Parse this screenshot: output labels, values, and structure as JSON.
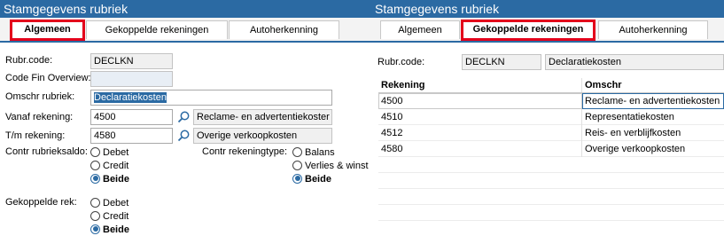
{
  "left": {
    "title": "Stamgegevens rubriek",
    "tabs": [
      "Algemeen",
      "Gekoppelde rekeningen",
      "Autoherkenning"
    ],
    "active_tab": "Algemeen",
    "fields": {
      "rubr_code_label": "Rubr.code:",
      "rubr_code_value": "DECLKN",
      "code_fin_label": "Code Fin Overview:",
      "code_fin_value": "",
      "omschr_label": "Omschr rubriek:",
      "omschr_value": "Declaratiekosten",
      "vanaf_label": "Vanaf rekening:",
      "vanaf_value": "4500",
      "vanaf_desc": "Reclame- en advertentiekoster",
      "tm_label": "T/m rekening:",
      "tm_value": "4580",
      "tm_desc": "Overige verkoopkosten"
    },
    "saldo": {
      "label": "Contr rubrieksaldo:",
      "options": [
        "Debet",
        "Credit",
        "Beide"
      ],
      "selected": "Beide"
    },
    "rekeningtype": {
      "label": "Contr rekeningtype:",
      "options": [
        "Balans",
        "Verlies & winst",
        "Beide"
      ],
      "selected": "Beide"
    },
    "gekoppelde": {
      "label": "Gekoppelde rek:",
      "options": [
        "Debet",
        "Credit",
        "Beide"
      ],
      "selected": "Beide"
    }
  },
  "right": {
    "title": "Stamgegevens rubriek",
    "tabs": [
      "Algemeen",
      "Gekoppelde rekeningen",
      "Autoherkenning"
    ],
    "active_tab": "Gekoppelde rekeningen",
    "rubr_code_label": "Rubr.code:",
    "rubr_code_value": "DECLKN",
    "rubr_desc_value": "Declaratiekosten",
    "table": {
      "headers": [
        "Rekening",
        "Omschr"
      ],
      "rows": [
        [
          "4500",
          "Reclame- en advertentiekosten"
        ],
        [
          "4510",
          "Representatiekosten"
        ],
        [
          "4512",
          "Reis- en verblijfkosten"
        ],
        [
          "4580",
          "Overige verkoopkosten"
        ]
      ]
    }
  },
  "colors": {
    "accent": "#2b6aa3",
    "highlight_border": "#e3001b"
  },
  "icons": [
    "search-icon",
    "radio-icon"
  ]
}
